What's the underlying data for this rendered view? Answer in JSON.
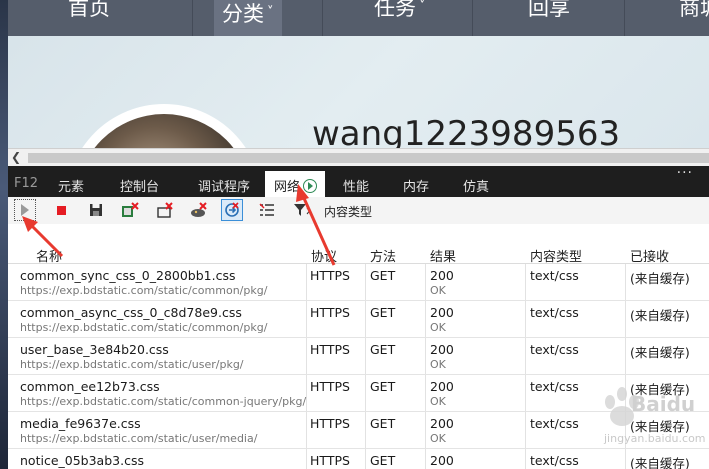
{
  "site_nav": {
    "items": [
      {
        "label": "首页",
        "has_arrow": false
      },
      {
        "label": "分类",
        "has_arrow": true
      },
      {
        "label": "任务",
        "has_arrow": true
      },
      {
        "label": "回享",
        "has_arrow": false
      },
      {
        "label": "商城",
        "has_arrow": false
      }
    ],
    "arrow_glyph": "˅"
  },
  "profile": {
    "username": "wang1223989563"
  },
  "devtools": {
    "f12_label": "F12",
    "tabs": [
      "元素",
      "控制台",
      "调试程序",
      "网络",
      "性能",
      "内存",
      "仿真"
    ],
    "active_tab": "网络",
    "more_glyph": "...",
    "toolbar": {
      "icons": [
        "play-icon",
        "stop-icon",
        "save-icon",
        "clear-cache-icon",
        "clear-entries-icon",
        "clear-cookies-icon",
        "always-refresh-icon",
        "filter-list-icon",
        "filter-icon"
      ],
      "content_type_label": "内容类型"
    },
    "columns": [
      "名称",
      "协议",
      "方法",
      "结果",
      "内容类型",
      "已接收"
    ],
    "rows": [
      {
        "name": "common_sync_css_0_2800bb1.css",
        "url": "https://exp.bdstatic.com/static/common/pkg/",
        "protocol": "HTTPS",
        "method": "GET",
        "status": "200",
        "status_text": "OK",
        "type": "text/css",
        "received": "(来自缓存)"
      },
      {
        "name": "common_async_css_0_c8d78e9.css",
        "url": "https://exp.bdstatic.com/static/common/pkg/",
        "protocol": "HTTPS",
        "method": "GET",
        "status": "200",
        "status_text": "OK",
        "type": "text/css",
        "received": "(来自缓存)"
      },
      {
        "name": "user_base_3e84b20.css",
        "url": "https://exp.bdstatic.com/static/user/pkg/",
        "protocol": "HTTPS",
        "method": "GET",
        "status": "200",
        "status_text": "OK",
        "type": "text/css",
        "received": "(来自缓存)"
      },
      {
        "name": "common_ee12b73.css",
        "url": "https://exp.bdstatic.com/static/common-jquery/pkg/",
        "protocol": "HTTPS",
        "method": "GET",
        "status": "200",
        "status_text": "OK",
        "type": "text/css",
        "received": "(来自缓存)"
      },
      {
        "name": "media_fe9637e.css",
        "url": "https://exp.bdstatic.com/static/user/media/",
        "protocol": "HTTPS",
        "method": "GET",
        "status": "200",
        "status_text": "OK",
        "type": "text/css",
        "received": "(来自缓存)"
      },
      {
        "name": "notice_05b3ab3.css",
        "url": "",
        "protocol": "HTTPS",
        "method": "GET",
        "status": "200",
        "status_text": "",
        "type": "text/css",
        "received": "(来自缓存)"
      }
    ]
  },
  "watermark": {
    "site": "jingyan.baidu.com",
    "brand": "Baidu"
  },
  "colors": {
    "accent": "#e51c23",
    "devtools_bar": "#1e1e1e",
    "nav": "#555d6b",
    "record_green": "#2f8a56"
  }
}
